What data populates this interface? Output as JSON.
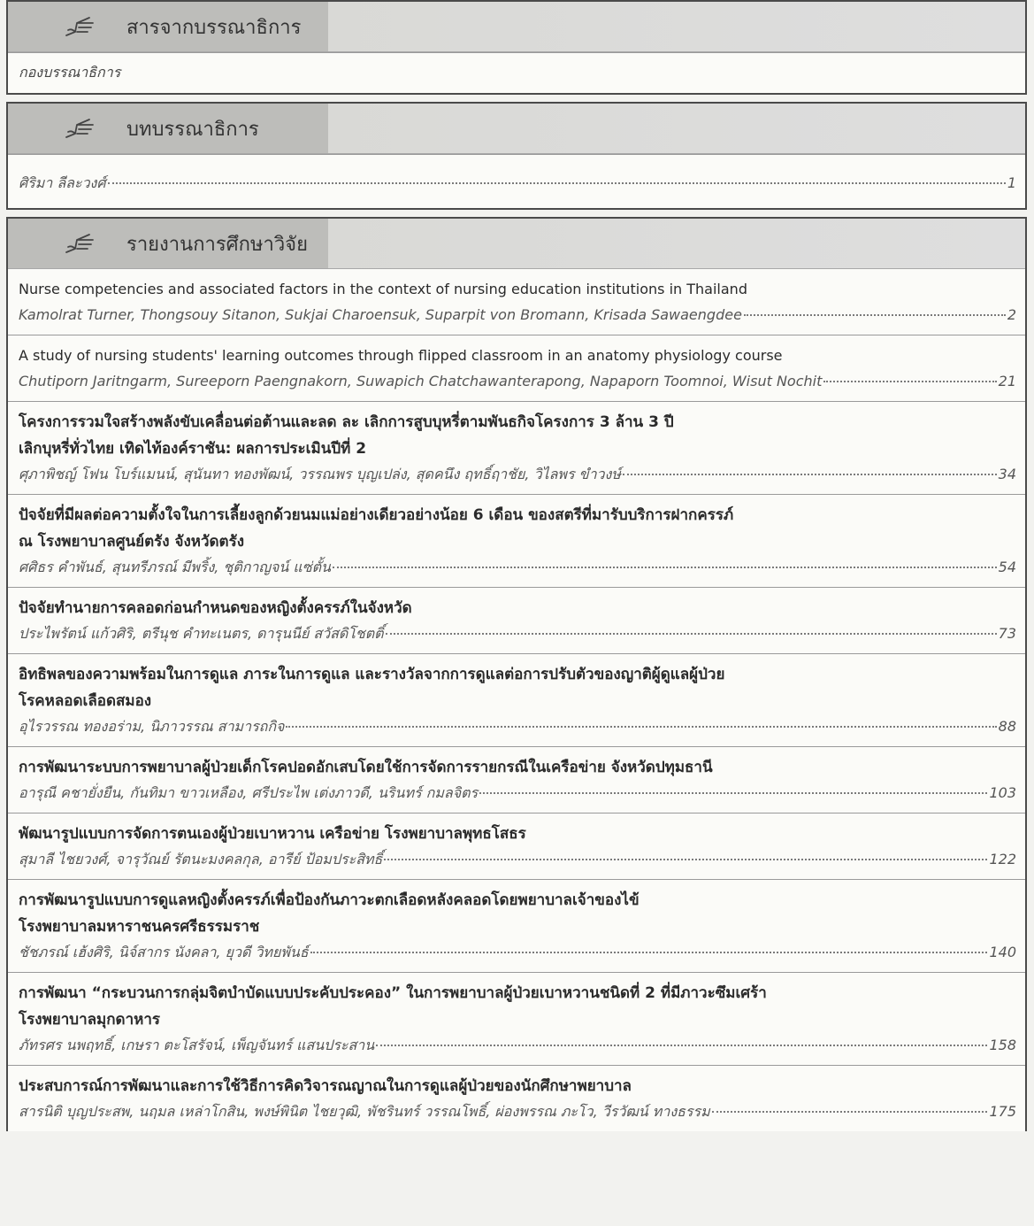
{
  "sections": [
    {
      "heading": "สารจากบรรณาธิการ",
      "author_line": "กองบรรณาธิการ"
    },
    {
      "heading": "บทบรรณาธิการ",
      "entry": {
        "authors": "ศิริมา ลีละวงศ์",
        "page": "1"
      }
    },
    {
      "heading": "รายงานการศึกษาวิจัย",
      "entries": [
        {
          "title": [
            "Nurse competencies and associated factors in the context of nursing education institutions in Thailand"
          ],
          "authors": "Kamolrat Turner, Thongsouy Sitanon, Sukjai Charoensuk, Suparpit von Bromann, Krisada Sawaengdee",
          "page": "2"
        },
        {
          "title": [
            "A study of nursing students' learning outcomes through flipped classroom in an anatomy physiology course"
          ],
          "authors": "Chutiporn Jaritngarm, Sureeporn Paengnakorn, Suwapich Chatchawanterapong, Napaporn Toomnoi, Wisut Nochit",
          "page": "21"
        },
        {
          "title": [
            "โครงการรวมใจสร้างพลังขับเคลื่อนต่อต้านและลด ละ เลิกการสูบบุหรี่ตามพันธกิจโครงการ 3 ล้าน 3 ปี",
            "เลิกบุหรี่ทั่วไทย เทิดไท้องค์ราชัน: ผลการประเมินปีที่ 2"
          ],
          "authors": "ศุภาพิชญ์ โฟน โบร์แมนน์, สุนันทา ทองพัฒน์, วรรณพร บุญเปล่ง, สุดคนึง ฤทธิ์ฤาชัย, วิไลพร ขำวงษ์",
          "page": "34"
        },
        {
          "title": [
            "ปัจจัยที่มีผลต่อความตั้งใจในการเลี้ยงลูกด้วยนมแม่อย่างเดียวอย่างน้อย 6 เดือน ของสตรีที่มารับบริการฝากครรภ์",
            "ณ โรงพยาบาลศูนย์ตรัง จังหวัดตรัง"
          ],
          "authors": "ศศิธร คำพันธ์, สุนทรีภรณ์ มีพริ้ง, ชุติกาญจน์ แซ่ตั้น",
          "page": "54"
        },
        {
          "title": [
            "ปัจจัยทำนายการคลอดก่อนกำหนดของหญิงตั้งครรภ์ในจังหวัด"
          ],
          "authors": "ประไพรัตน์ แก้วศิริ, ตรีนุช คำทะเนตร, ดารุนนีย์ สวัสดิโชตติ์",
          "page": "73"
        },
        {
          "title": [
            "อิทธิพลของความพร้อมในการดูแล ภาระในการดูแล และรางวัลจากการดูแลต่อการปรับตัวของญาติผู้ดูแลผู้ป่วย",
            "โรคหลอดเลือดสมอง"
          ],
          "authors": "อุไรวรรณ ทองอร่าม, นิภาวรรณ สามารถกิจ",
          "page": "88"
        },
        {
          "title": [
            "การพัฒนาระบบการพยาบาลผู้ป่วยเด็กโรคปอดอักเสบโดยใช้การจัดการรายกรณีในเครือข่าย จังหวัดปทุมธานี"
          ],
          "authors": "อารุณี คชายั่งยืน, กันทิมา ขาวเหลือง, ศรีประไพ เต่งภาวดี, นรินทร์ กมลจิตร",
          "page": "103"
        },
        {
          "title": [
            "พัฒนารูปแบบการจัดการตนเองผู้ป่วยเบาหวาน เครือข่าย โรงพยาบาลพุทธโสธร"
          ],
          "authors": "สุมาลี ไชยวงศ์, จารุวัณย์ รัตนะมงคลกุล, อารีย์ ป้อมประสิทธิ์",
          "page": "122"
        },
        {
          "title": [
            "การพัฒนารูปแบบการดูแลหญิงตั้งครรภ์เพื่อป้องกันภาวะตกเลือดหลังคลอดโดยพยาบาลเจ้าของไข้",
            "โรงพยาบาลมหาราชนครศรีธรรมราช"
          ],
          "authors": "ชัชภรณ์ เฮ้งศิริ, นิจ์สากร นังคลา, ยุวดี วิทยพันธ์",
          "page": "140"
        },
        {
          "title": [
            "การพัฒนา “กระบวนการกลุ่มจิตบำบัดแบบประคับประคอง” ในการพยาบาลผู้ป่วยเบาหวานชนิดที่ 2 ที่มีภาวะซึมเศร้า",
            "โรงพยาบาลมุกดาหาร"
          ],
          "authors": "ภัทรศร นพฤทธิ์, เกษรา ตะโสรัจน์, เพ็ญจันทร์ แสนประสาน",
          "page": "158"
        },
        {
          "title": [
            "ประสบการณ์การพัฒนาและการใช้วิธีการคิดวิจารณญาณในการดูแลผู้ป่วยของนักศึกษาพยาบาล"
          ],
          "authors": "สารนิติ บุญประสพ, นฤมล เหล่าโกสิน, พงษ์พินิต ไชยวุฒิ, พัชรินทร์ วรรณโพธิ์, ผ่องพรรณ ภะโว, วีรวัฒน์ ทางธรรม",
          "page": "175"
        }
      ]
    }
  ]
}
